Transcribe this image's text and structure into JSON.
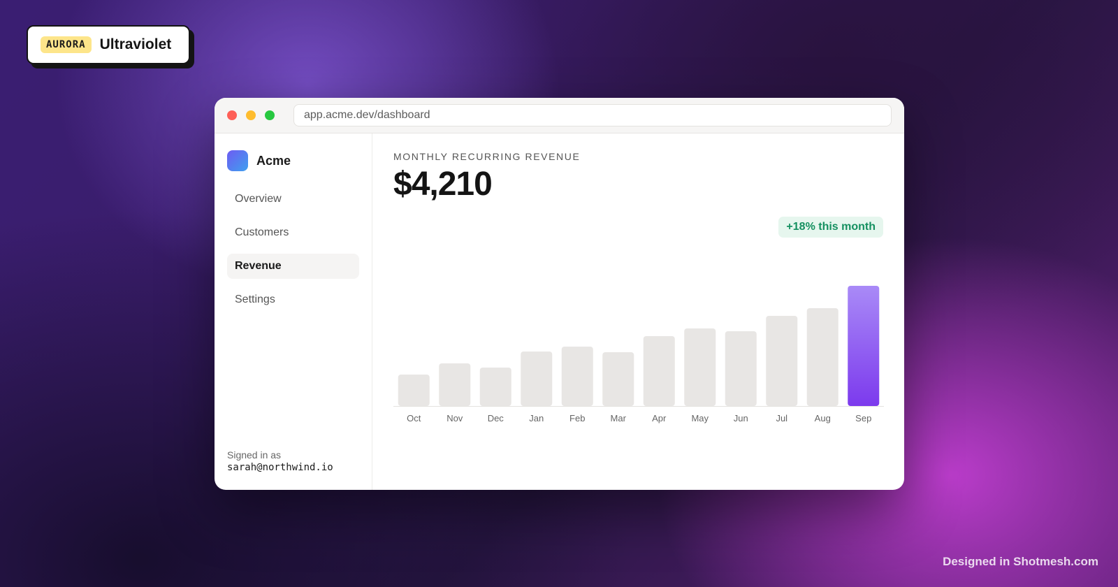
{
  "badge": {
    "tag": "AURORA",
    "name": "Ultraviolet"
  },
  "window": {
    "url": "app.acme.dev/dashboard"
  },
  "sidebar": {
    "brand": "Acme",
    "items": [
      {
        "label": "Overview",
        "active": false
      },
      {
        "label": "Customers",
        "active": false
      },
      {
        "label": "Revenue",
        "active": true
      },
      {
        "label": "Settings",
        "active": false
      }
    ],
    "signed_in_label": "Signed in as",
    "signed_in_email": "sarah@northwind.io"
  },
  "main": {
    "kpi_label": "MONTHLY RECURRING REVENUE",
    "kpi_value": "$4,210",
    "delta": "+18% this month"
  },
  "colors": {
    "bar": "#e8e6e4",
    "highlight_top": "#a98af7",
    "highlight_bottom": "#7c3aed",
    "delta_bg": "#e6f6ee",
    "delta_text": "#159060"
  },
  "chart_data": {
    "type": "bar",
    "categories": [
      "Oct",
      "Nov",
      "Dec",
      "Jan",
      "Feb",
      "Mar",
      "Apr",
      "May",
      "Jun",
      "Jul",
      "Aug",
      "Sep"
    ],
    "values": [
      45,
      61,
      55,
      78,
      85,
      77,
      100,
      111,
      107,
      129,
      140,
      172
    ],
    "highlight_index": 11,
    "grid": false
  },
  "footer": {
    "credit": "Designed in Shotmesh.com"
  }
}
